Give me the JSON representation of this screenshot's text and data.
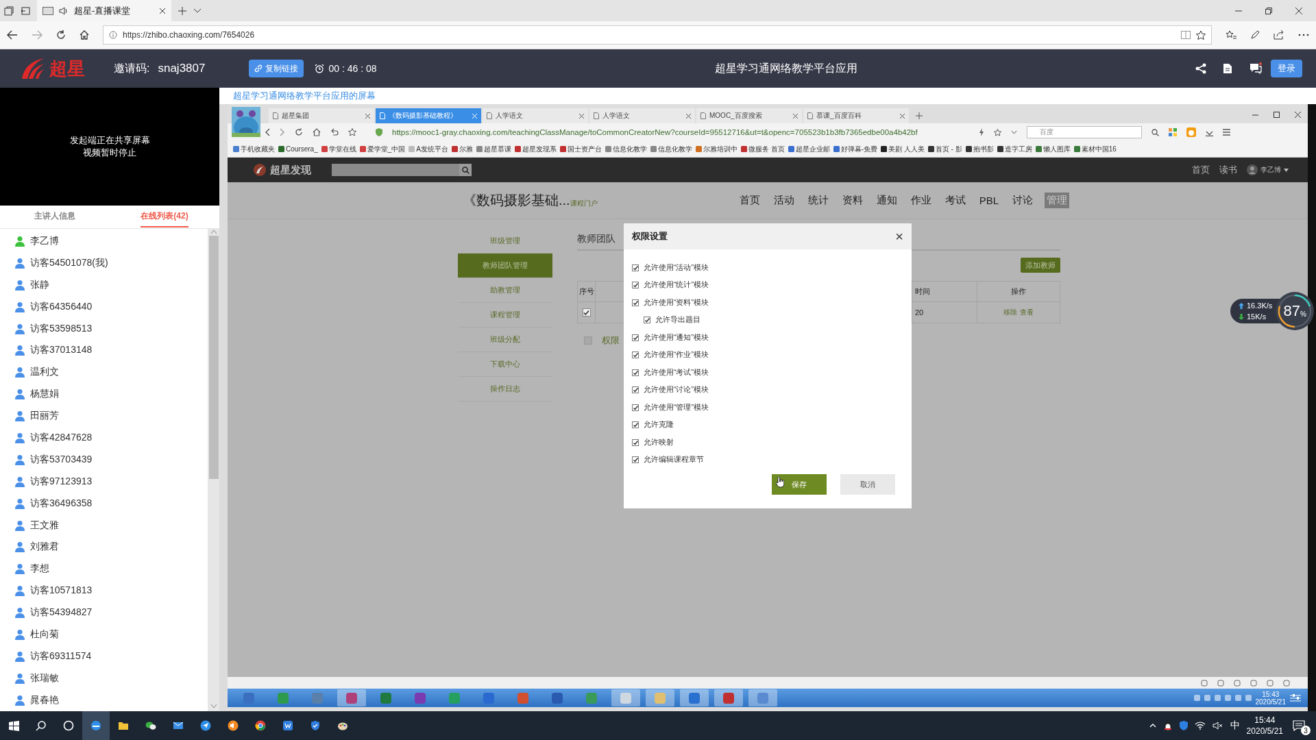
{
  "outer_browser": {
    "tab_title": "超星-直播课堂",
    "url": "https://zhibo.chaoxing.com/7654026"
  },
  "header": {
    "logo": "超星",
    "invite_label": "邀请码:",
    "invite_code": "snaj3807",
    "copy_button": "复制链接",
    "timer": "00 : 46 : 08",
    "title": "超星学习通网络教学平台应用",
    "login_button": "登录"
  },
  "video": {
    "lines": [
      "发起端正在共享屏幕",
      "视频暂时停止"
    ]
  },
  "side_tabs": [
    {
      "label": "主讲人信息",
      "selected": false
    },
    {
      "label": "在线列表(42)",
      "selected": true
    }
  ],
  "attendees": [
    {
      "name": "李乙博",
      "kind": "host"
    },
    {
      "name": "访客54501078(我)",
      "kind": "guest"
    },
    {
      "name": "张静",
      "kind": "guest"
    },
    {
      "name": "访客64356440",
      "kind": "guest"
    },
    {
      "name": "访客53598513",
      "kind": "guest"
    },
    {
      "name": "访客37013148",
      "kind": "guest"
    },
    {
      "name": "温利文",
      "kind": "guest"
    },
    {
      "name": "杨慧娟",
      "kind": "guest"
    },
    {
      "name": "田丽芳",
      "kind": "guest"
    },
    {
      "name": "访客42847628",
      "kind": "guest"
    },
    {
      "name": "访客53703439",
      "kind": "guest"
    },
    {
      "name": "访客97123913",
      "kind": "guest"
    },
    {
      "name": "访客36496358",
      "kind": "guest"
    },
    {
      "name": "王文雅",
      "kind": "guest"
    },
    {
      "name": "刘雅君",
      "kind": "guest"
    },
    {
      "name": "李想",
      "kind": "guest"
    },
    {
      "name": "访客10571813",
      "kind": "guest"
    },
    {
      "name": "访客54394827",
      "kind": "guest"
    },
    {
      "name": "杜向菊",
      "kind": "guest"
    },
    {
      "name": "访客69311574",
      "kind": "guest"
    },
    {
      "name": "张瑞敏",
      "kind": "guest"
    },
    {
      "name": "晁春艳",
      "kind": "guest"
    }
  ],
  "share_title": "超星学习通网络教学平台应用的屏幕",
  "shared_screen": {
    "browser": {
      "tabs": [
        {
          "label": "超星集团",
          "selected": false
        },
        {
          "label": "《数码摄影基础教程》",
          "selected": true
        },
        {
          "label": "人学语文",
          "selected": false
        },
        {
          "label": "人学语文",
          "selected": false
        },
        {
          "label": "MOOC_百度搜索",
          "selected": false
        },
        {
          "label": "慕课_百度百科",
          "selected": false
        }
      ],
      "url": "https://mooc1-gray.chaoxing.com/teachingClassManage/toCommonCreatorNew?courseId=95512716&ut=t&openc=705523b1b3fb7365edbe00a4b42bf",
      "search": {
        "placeholder": "百度"
      },
      "bookmarks": [
        "手机收藏夹",
        "Coursera_",
        "学堂在线",
        "爱学堂_中国",
        "A发统平台",
        "尔雅",
        "超星慕课",
        "超星发现系",
        "国士资产台",
        "信息化教学",
        "信息化教学",
        "尔雅培训中",
        "微服务 首页",
        "超星企业邮",
        "好弹幕-免费",
        "美剧 人人美",
        "首页 - 影",
        "抱书影",
        "造字工房",
        "懒人图库",
        "素材中国16"
      ]
    },
    "site": {
      "logo": "超星发现",
      "nav": [
        "首页",
        "读书"
      ],
      "user": "李乙博"
    },
    "course": {
      "title": "《数码摄影基础...",
      "portal": "课程门户",
      "nav": [
        {
          "label": "首页",
          "selected": false
        },
        {
          "label": "活动",
          "selected": false
        },
        {
          "label": "统计",
          "selected": false
        },
        {
          "label": "资料",
          "selected": false
        },
        {
          "label": "通知",
          "selected": false
        },
        {
          "label": "作业",
          "selected": false
        },
        {
          "label": "考试",
          "selected": false
        },
        {
          "label": "PBL",
          "selected": false
        },
        {
          "label": "讨论",
          "selected": false
        },
        {
          "label": "管理",
          "selected": true
        }
      ]
    },
    "menu": [
      {
        "label": "班级管理",
        "selected": false
      },
      {
        "label": "教师团队管理",
        "selected": true
      },
      {
        "label": "助教管理",
        "selected": false
      },
      {
        "label": "课程管理",
        "selected": false
      },
      {
        "label": "班级分配",
        "selected": false
      },
      {
        "label": "下载中心",
        "selected": false
      },
      {
        "label": "操作日志",
        "selected": false
      }
    ],
    "panel": {
      "heading": "教师团队",
      "add_button": "添加教师",
      "columns": [
        "序号",
        "时间",
        "操作"
      ],
      "rows": [
        {
          "checked": true,
          "time": "20",
          "actions": [
            "移除",
            "查看"
          ]
        }
      ],
      "select_all": {
        "checked": false,
        "label": "权限"
      }
    },
    "dialog": {
      "title": "权限设置",
      "close": "×",
      "permissions": [
        {
          "label": "允许使用“活动”模块",
          "checked": true
        },
        {
          "label": "允许使用“统计”模块",
          "checked": true
        },
        {
          "label": "允许使用“资料”模块",
          "checked": true,
          "children": [
            {
              "label": "允许导出题目",
              "checked": true
            }
          ]
        },
        {
          "label": "允许使用“通知”模块",
          "checked": true
        },
        {
          "label": "允许使用“作业”模块",
          "checked": true
        },
        {
          "label": "允许使用“考试”模块",
          "checked": true
        },
        {
          "label": "允许使用“讨论”模块",
          "checked": true
        },
        {
          "label": "允许使用“管理”模块",
          "checked": true
        },
        {
          "label": "允许克隆",
          "checked": true
        },
        {
          "label": "允许映射",
          "checked": true
        },
        {
          "label": "允许编辑课程章节",
          "checked": true
        }
      ],
      "save_button": "保存",
      "cancel_button": "取消"
    },
    "inner_taskbar": {
      "time": "15:43",
      "date": "2020/5/21"
    }
  },
  "net_widget": {
    "upload": "16.3K/s",
    "download": "15K/s",
    "usage": "87",
    "usage_unit": "%"
  },
  "taskbar": {
    "ime": "中",
    "time": "15:44",
    "date": "2020/5/21",
    "notifications": "3"
  }
}
